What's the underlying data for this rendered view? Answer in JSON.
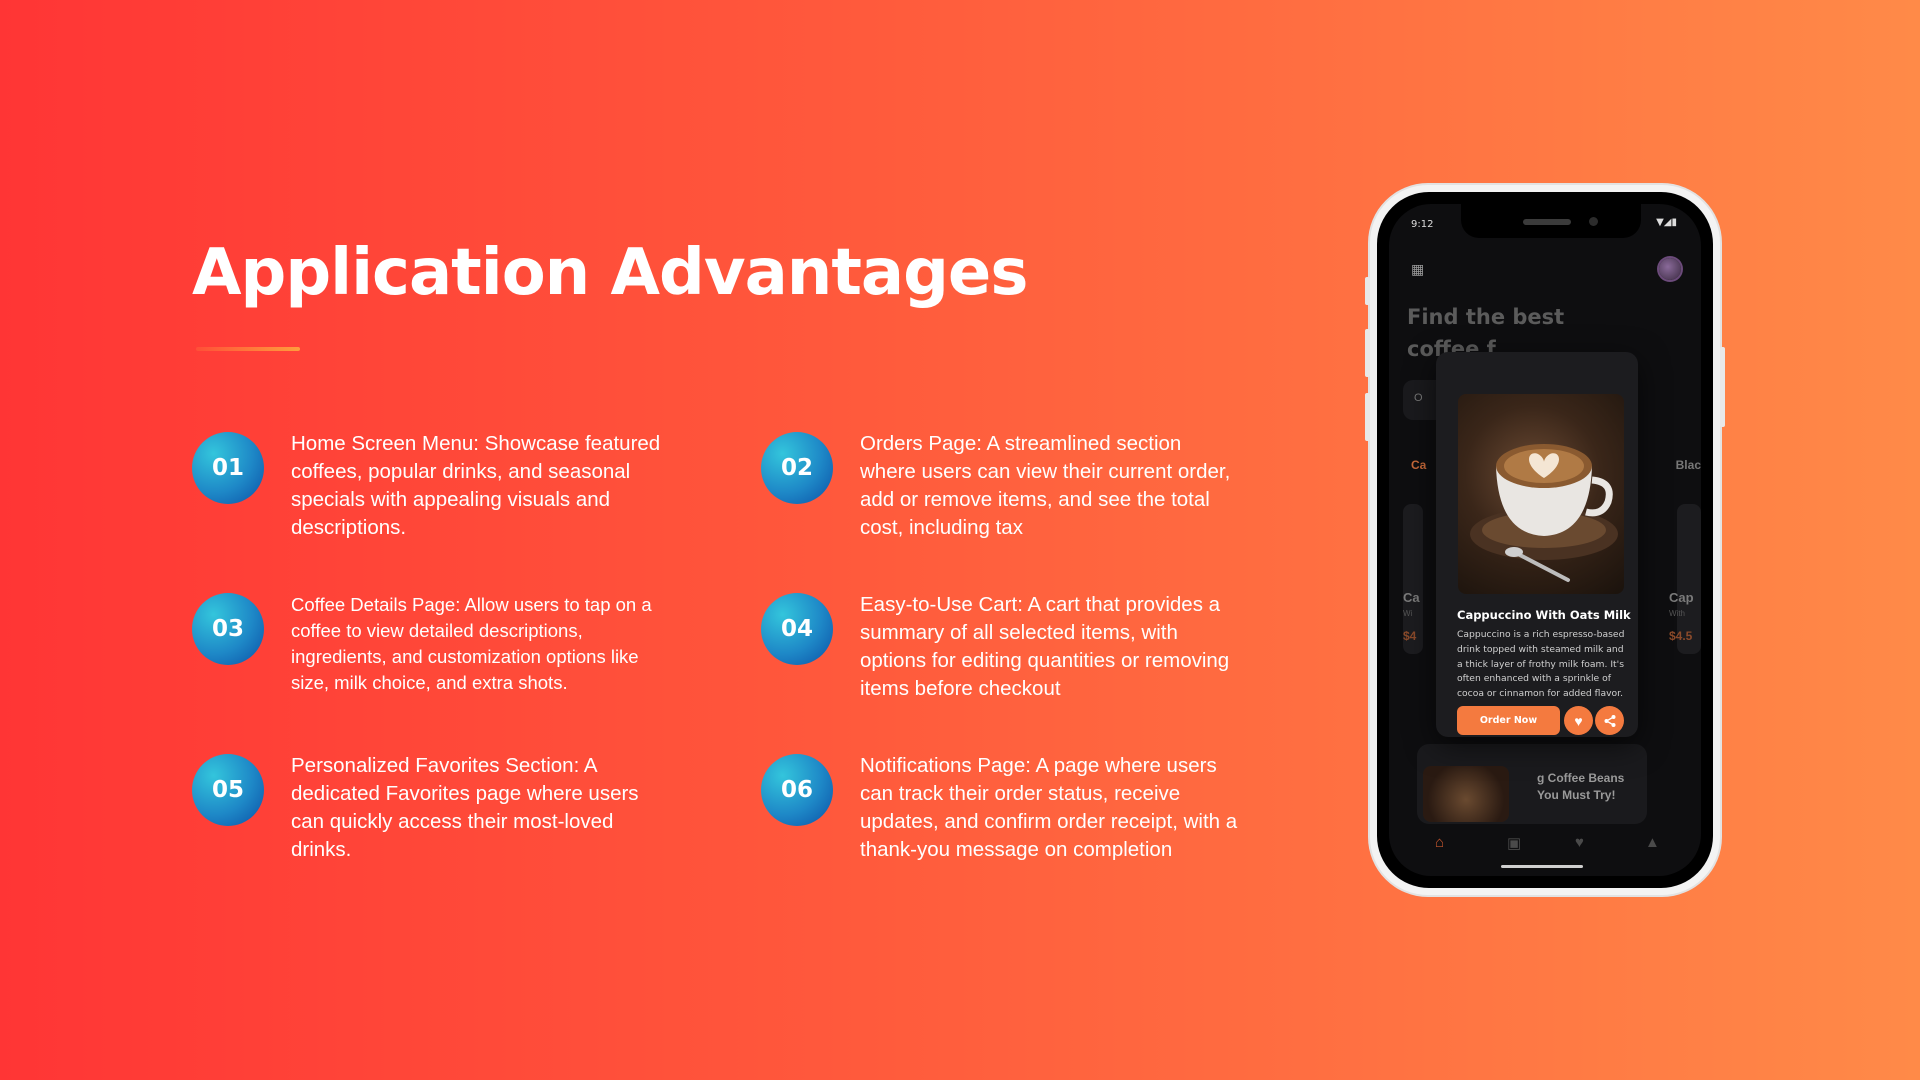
{
  "title": "Application Advantages",
  "features": [
    {
      "num": "01",
      "text": "Home Screen Menu: Showcase featured coffees, popular drinks, and seasonal specials with appealing visuals and descriptions."
    },
    {
      "num": "02",
      "text": "Orders Page: A streamlined section where users can view their current order, add or remove items, and see the total cost, including tax"
    },
    {
      "num": "03",
      "text": "Coffee Details Page: Allow users to tap on a coffee to view detailed descriptions, ingredients, and customization options like size, milk choice, and extra shots."
    },
    {
      "num": "04",
      "text": "Easy-to-Use Cart: A cart that provides a summary of all selected items, with options for editing quantities or removing items before checkout"
    },
    {
      "num": "05",
      "text": "Personalized Favorites Section: A dedicated Favorites page where users can quickly access their most-loved drinks."
    },
    {
      "num": "06",
      "text": "Notifications Page: A page where users can track their order status, receive updates, and confirm order receipt, with a thank-you message on completion"
    }
  ],
  "phone": {
    "status_time": "9:12",
    "status_icons": "▼◢▮",
    "headline": "Find the best coffee f",
    "search_char": "O",
    "tab_left": "Ca",
    "tab_right": "Blac",
    "ghost_left_name": "Ca",
    "ghost_left_sub": "Wi",
    "ghost_left_price": "$4",
    "ghost_right_name": "Cap",
    "ghost_right_sub": "With",
    "ghost_right_price": "$4.5",
    "bottom_card_text": "g Coffee Beans You Must Try!",
    "popup": {
      "title": "Cappuccino With Oats Milk",
      "description": "Cappuccino is a rich espresso-based drink topped with steamed milk and a thick layer of frothy milk foam. It's often enhanced with a sprinkle of cocoa or cinnamon for added flavor.",
      "order_button": "Order Now",
      "favorite_icon": "heart-icon",
      "share_icon": "share-icon"
    },
    "nav_icons": [
      "home-icon",
      "bag-icon",
      "heart-icon",
      "bell-icon"
    ],
    "accent_color": "#f47a3f"
  },
  "colors": {
    "background_start": "#ff3535",
    "background_end": "#ff8a48",
    "badge": "#1e88c7"
  }
}
